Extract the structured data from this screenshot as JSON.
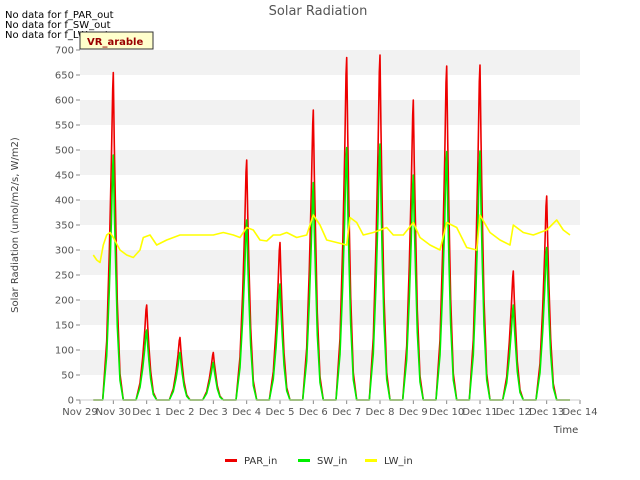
{
  "chart_data": {
    "type": "line",
    "title": "Solar Radiation",
    "xlabel": "Time",
    "ylabel": "Solar Radiation (umol/m2/s, W/m2)",
    "ylim": [
      0,
      700
    ],
    "yticks": [
      0,
      50,
      100,
      150,
      200,
      250,
      300,
      350,
      400,
      450,
      500,
      550,
      600,
      650,
      700
    ],
    "xlim": [
      0,
      15
    ],
    "xticks": [
      {
        "value": 0,
        "label": "Nov 29"
      },
      {
        "value": 1,
        "label": "Nov 30"
      },
      {
        "value": 2,
        "label": "Dec 1"
      },
      {
        "value": 3,
        "label": "Dec 2"
      },
      {
        "value": 4,
        "label": "Dec 3"
      },
      {
        "value": 5,
        "label": "Dec 4"
      },
      {
        "value": 6,
        "label": "Dec 5"
      },
      {
        "value": 7,
        "label": "Dec 6"
      },
      {
        "value": 8,
        "label": "Dec 7"
      },
      {
        "value": 9,
        "label": "Dec 8"
      },
      {
        "value": 10,
        "label": "Dec 9"
      },
      {
        "value": 11,
        "label": "Dec 10"
      },
      {
        "value": 12,
        "label": "Dec 11"
      },
      {
        "value": 13,
        "label": "Dec 12"
      },
      {
        "value": 14,
        "label": "Dec 13"
      },
      {
        "value": 15,
        "label": "Dec 14"
      }
    ],
    "grid": "horizontal bands",
    "legend_position": "bottom",
    "series": [
      {
        "name": "PAR_in",
        "color": "#ee0000",
        "daily_peaks": [
          655,
          190,
          125,
          95,
          480,
          315,
          580,
          685,
          690,
          600,
          668,
          670,
          258,
          408
        ]
      },
      {
        "name": "SW_in",
        "color": "#00ee00",
        "daily_peaks": [
          490,
          140,
          95,
          75,
          360,
          232,
          435,
          505,
          512,
          450,
          497,
          498,
          190,
          305
        ]
      },
      {
        "name": "LW_in",
        "color": "#ffff00",
        "points": [
          [
            0.4,
            290
          ],
          [
            0.5,
            280
          ],
          [
            0.6,
            275
          ],
          [
            0.7,
            310
          ],
          [
            0.8,
            330
          ],
          [
            0.9,
            335
          ],
          [
            1.0,
            325
          ],
          [
            1.2,
            300
          ],
          [
            1.4,
            290
          ],
          [
            1.6,
            285
          ],
          [
            1.8,
            300
          ],
          [
            1.9,
            325
          ],
          [
            2.1,
            330
          ],
          [
            2.3,
            310
          ],
          [
            2.6,
            320
          ],
          [
            3.0,
            330
          ],
          [
            3.5,
            330
          ],
          [
            4.0,
            330
          ],
          [
            4.3,
            335
          ],
          [
            4.6,
            330
          ],
          [
            4.8,
            325
          ],
          [
            5.0,
            345
          ],
          [
            5.2,
            340
          ],
          [
            5.4,
            320
          ],
          [
            5.6,
            318
          ],
          [
            5.8,
            330
          ],
          [
            6.0,
            330
          ],
          [
            6.2,
            335
          ],
          [
            6.5,
            325
          ],
          [
            6.8,
            330
          ],
          [
            7.0,
            370
          ],
          [
            7.2,
            350
          ],
          [
            7.4,
            320
          ],
          [
            7.7,
            315
          ],
          [
            8.0,
            310
          ],
          [
            8.1,
            365
          ],
          [
            8.3,
            355
          ],
          [
            8.5,
            330
          ],
          [
            8.8,
            335
          ],
          [
            9.0,
            340
          ],
          [
            9.2,
            345
          ],
          [
            9.4,
            330
          ],
          [
            9.7,
            330
          ],
          [
            10.0,
            355
          ],
          [
            10.2,
            325
          ],
          [
            10.5,
            310
          ],
          [
            10.8,
            300
          ],
          [
            11.0,
            355
          ],
          [
            11.3,
            345
          ],
          [
            11.6,
            305
          ],
          [
            11.9,
            300
          ],
          [
            12.0,
            370
          ],
          [
            12.3,
            335
          ],
          [
            12.6,
            320
          ],
          [
            12.9,
            310
          ],
          [
            13.0,
            350
          ],
          [
            13.3,
            335
          ],
          [
            13.6,
            330
          ],
          [
            14.0,
            340
          ],
          [
            14.3,
            360
          ],
          [
            14.5,
            340
          ],
          [
            14.7,
            330
          ]
        ]
      }
    ],
    "notes": [
      "No data for f_PAR_out",
      "No data for f_SW_out",
      "No data for f_LW_out"
    ],
    "badge": "VR_arable"
  }
}
